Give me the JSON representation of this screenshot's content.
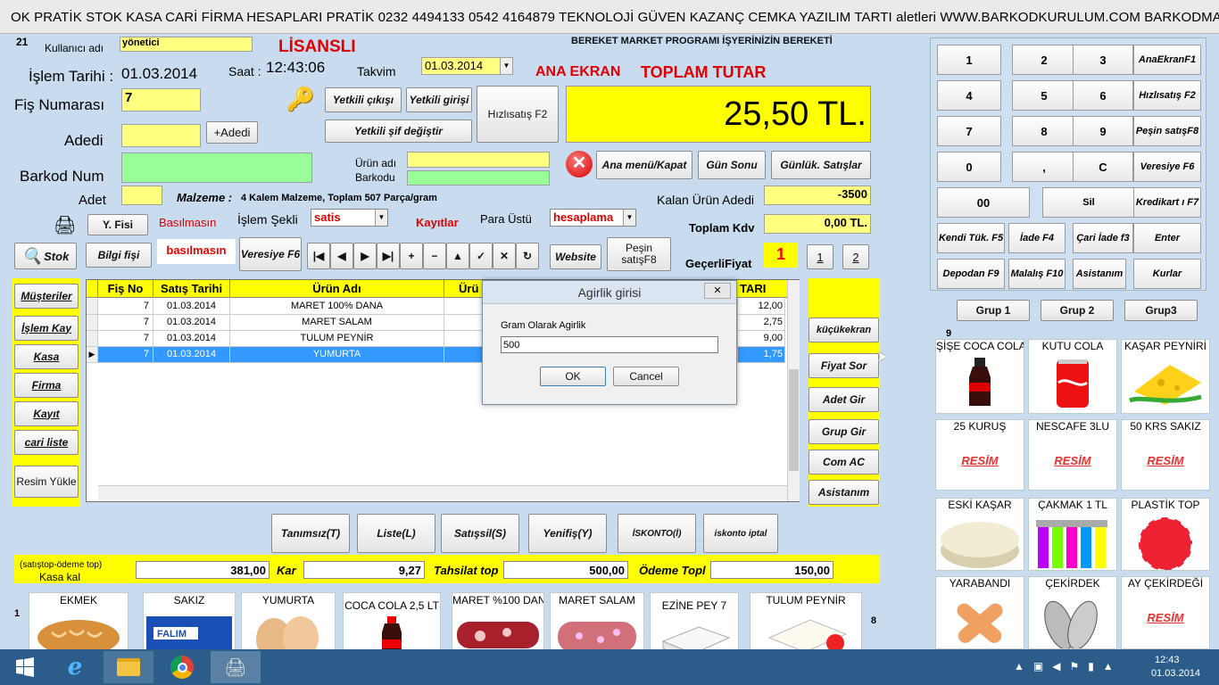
{
  "window": {
    "title": "OK PRATİK STOK KASA CARİ FİRMA HESAPLARI PRATİK 0232 4494133  0542 4164879 TEKNOLOJİ GÜVEN KAZANÇ  CEMKA  YAZILIM TARTI aletleri WWW.BARKODKURULUM.COM     BARKODMATİK BAR..."
  },
  "header": {
    "num": "21",
    "user_label": "Kullanıcı adı",
    "user_value": "yönetici",
    "license": "LİSANSLI",
    "slogan": "BEREKET MARKET PROGRAMI İŞYERİNİZİN BEREKETİ",
    "date_label": "İşlem Tarihi :",
    "date_value": "01.03.2014",
    "time_label": "Saat :",
    "time_value": "12:43:06",
    "calendar_label": "Takvim",
    "calendar_value": "01.03.2014",
    "main_screen": "ANA EKRAN",
    "total_label": "TOPLAM TUTAR",
    "total_value": "25,50 TL.",
    "receipt_label": "Fiş Numarası",
    "receipt_value": "7",
    "qty_label": "Adedi",
    "add_qty": "+Adedi",
    "barcode_label": "Barkod Num",
    "piece_label": "Adet",
    "product_label": "Ürün adı",
    "product_barcode_label": "Barkodu",
    "material_label": "Malzeme :",
    "material_value": "4 Kalem Malzeme, Toplam 507 Parça/gram",
    "remaining_label": "Kalan Ürün Adedi",
    "remaining_value": "-3500",
    "vat_label": "Toplam Kdv",
    "vat_value": "0,00 TL.",
    "print_label": "Basılmasın",
    "op_label": "İşlem Şekli",
    "op_value": "satis",
    "records_label": "Kayıtlar",
    "change_label": "Para Üstü",
    "change_value": "hesaplama",
    "valid_price_label": "GeçerliFiyat",
    "valid_price_value": "1",
    "print2": "basılmasın"
  },
  "buttons": {
    "auth_out": "Yetkili çıkışı",
    "auth_in": "Yetkili girişi",
    "quick_sale": "Hızlısatış F2",
    "auth_pw": "Yetkili şif değiştir",
    "main_close": "Ana menü/Kapat",
    "day_end": "Gün Sonu",
    "daily_sales": "Günlük. Satışlar",
    "y_fisi": "Y. Fisi",
    "stock": "Stok",
    "info_slip": "Bilgi fişi",
    "credit": "Veresiye F6",
    "website": "Website",
    "cash_sale": "Peşin satışF8",
    "p1": "1",
    "p2": "2"
  },
  "nav": [
    "|◀",
    "◀",
    "▶",
    "▶|",
    "+",
    "−",
    "▲",
    "✓",
    "✕",
    "↻"
  ],
  "left_menu": [
    "Müşteriler",
    "İşlem Kay",
    "Kasa",
    "Firma",
    "Kayıt",
    "cari liste",
    "Resim Yükle"
  ],
  "right_menu": [
    "küçükekran",
    "Fiyat Sor",
    "Adet Gir",
    "Grup Gir",
    "Com AC",
    "Asistanım"
  ],
  "grid": {
    "headers": [
      "Fiş No",
      "Satış Tarihi",
      "Ürün Adı",
      "Ürü",
      "TARI"
    ],
    "rows": [
      {
        "no": "7",
        "date": "01.03.2014",
        "name": "MARET 100% DANA",
        "price": "12,00"
      },
      {
        "no": "7",
        "date": "01.03.2014",
        "name": "MARET SALAM",
        "price": "2,75"
      },
      {
        "no": "7",
        "date": "01.03.2014",
        "name": "TULUM PEYNİR",
        "price": "9,00"
      },
      {
        "no": "7",
        "date": "01.03.2014",
        "name": "YUMURTA",
        "price": "1,75"
      }
    ]
  },
  "dialog": {
    "title": "Agirlik girisi",
    "prompt": "Gram Olarak Agirlik",
    "value": "500",
    "ok": "OK",
    "cancel": "Cancel"
  },
  "actions": [
    "Tanımsız(T)",
    "Liste(L)",
    "Satışsil(S)",
    "Yenifiş(Y)",
    "İSKONTO(İ)",
    "iskonto iptal"
  ],
  "summary": {
    "caption1": "(satıştop-ödeme top)",
    "caption2": "Kasa kal",
    "cash_value": "381,00",
    "profit_label": "Kar",
    "profit_value": "9,27",
    "collect_label": "Tahsilat top",
    "collect_value": "500,00",
    "pay_label": "Ödeme Topl",
    "pay_value": "150,00"
  },
  "keypad": [
    {
      "label": "1"
    },
    {
      "label": "2"
    },
    {
      "label": "3"
    },
    {
      "label": "AnaEkranF1"
    },
    {
      "label": "4"
    },
    {
      "label": "5"
    },
    {
      "label": "6"
    },
    {
      "label": "Hızlısatış F2"
    },
    {
      "label": "7"
    },
    {
      "label": "8"
    },
    {
      "label": "9"
    },
    {
      "label": "Peşin satışF8"
    },
    {
      "label": "0"
    },
    {
      "label": ","
    },
    {
      "label": "C"
    },
    {
      "label": "Veresiye F6"
    },
    {
      "label": "00"
    },
    {
      "label": "Sil"
    },
    {
      "label": "Kredikart ı F7"
    },
    {
      "label": "Kendi Tük. F5"
    },
    {
      "label": "İade F4"
    },
    {
      "label": "Çari İade f3"
    },
    {
      "label": "Enter"
    },
    {
      "label": "Depodan F9"
    },
    {
      "label": "Malalış F10"
    },
    {
      "label": "Asistanım"
    },
    {
      "label": "Kurlar"
    }
  ],
  "groups": [
    "Grup 1",
    "Grup 2",
    "Grup3"
  ],
  "products": {
    "page": "9",
    "items": [
      {
        "name": "ŞİŞE COCA COLA",
        "icon": "coca-cola-bottle"
      },
      {
        "name": "KUTU COLA",
        "icon": "cola-can"
      },
      {
        "name": "KAŞAR PEYNİRİ",
        "icon": "cheese"
      },
      {
        "name": "25 KURUŞ",
        "resim": "RESİM"
      },
      {
        "name": "NESCAFE 3LU",
        "resim": "RESİM"
      },
      {
        "name": "50 KRS SAKIZ",
        "resim": "RESİM"
      },
      {
        "name": "ESKİ KAŞAR",
        "icon": "cheese-wheel"
      },
      {
        "name": "ÇAKMAK 1 TL",
        "icon": "lighters"
      },
      {
        "name": "PLASTİK TOP",
        "icon": "ball"
      },
      {
        "name": "YARABANDI",
        "icon": "bandage"
      },
      {
        "name": "ÇEKİRDEK",
        "icon": "seeds"
      },
      {
        "name": "AY ÇEKİRDEĞİ",
        "resim": "RESİM"
      }
    ]
  },
  "bottom": {
    "left_num": "1",
    "right_num": "8",
    "items": [
      "EKMEK",
      "SAKIZ",
      "YUMURTA",
      "COCA COLA 2,5 LT",
      "MARET %100 DANA",
      "MARET SALAM",
      "EZİNE PEY 7",
      "TULUM PEYNİR"
    ]
  },
  "gum_brand": "FALIM",
  "tray": {
    "time": "12:43",
    "date": "01.03.2014"
  }
}
